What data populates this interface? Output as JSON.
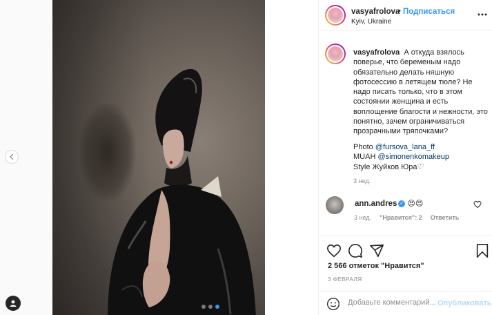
{
  "post": {
    "author": "vasyafrolova",
    "follow_label": "Подписаться",
    "separator": "•",
    "location": "Kyiv, Ukraine"
  },
  "caption": {
    "author": "vasyafrolova",
    "text": "А откуда взялось поверье, что беременым надо обязательно делать няшную фотосессию в летящем тюле? Не надо писать только, что в этом состоянии женщина и есть воплощение благости и нежности, это понятно, зачем ограничиваться прозрачными тряпочками?",
    "photo_label": "Photo ",
    "photo_link": "@fursova_lana_ff",
    "muah_label": "MUAH ",
    "muah_link": "@simonenkomakeup",
    "style_text": "Style Жуйков Юра",
    "heart": "♡",
    "time": "3 нед."
  },
  "comment": {
    "author": "ann.andres",
    "text": "😍😍",
    "time": "3 нед.",
    "likes_label": "\"Нравится\": 2",
    "reply_label": "Ответить"
  },
  "likes_text": "2 566 отметок \"Нравится\"",
  "date_text": "3 ФЕВРАЛЯ",
  "add_comment": {
    "placeholder": "Добавьте комментарий...",
    "publish_label": "Опубликовать"
  },
  "carousel": {
    "total": 3,
    "active_index": 2
  },
  "colors": {
    "accent": "#3897f0",
    "link": "#00376b",
    "muted": "#8e8e8e",
    "text": "#262626",
    "publish_disabled": "#b3dbff"
  },
  "icons": [
    "chevron-left-icon",
    "user-icon",
    "more-icon",
    "heart-icon",
    "comment-icon",
    "share-icon",
    "bookmark-icon",
    "emoji-icon",
    "verified-icon"
  ]
}
